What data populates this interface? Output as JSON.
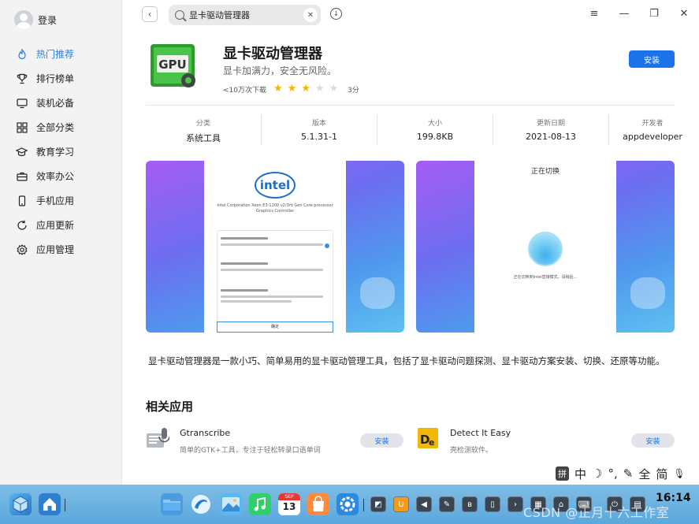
{
  "sidebar": {
    "login_label": "登录",
    "items": [
      {
        "label": "热门推荐",
        "icon": "hot-icon",
        "active": true
      },
      {
        "label": "排行榜单",
        "icon": "trophy-icon"
      },
      {
        "label": "装机必备",
        "icon": "monitor-icon"
      },
      {
        "label": "全部分类",
        "icon": "grid-icon"
      },
      {
        "label": "教育学习",
        "icon": "graduation-cap-icon"
      },
      {
        "label": "效率办公",
        "icon": "briefcase-icon"
      },
      {
        "label": "手机应用",
        "icon": "phone-icon"
      },
      {
        "label": "应用更新",
        "icon": "refresh-icon"
      },
      {
        "label": "应用管理",
        "icon": "gear-icon"
      }
    ]
  },
  "search": {
    "value": "显卡驱动管理器"
  },
  "window_controls": {
    "menu": "≡",
    "minimize": "—",
    "maximize": "❐",
    "close": "✕"
  },
  "app": {
    "icon_text": "GPU",
    "name": "显卡驱动管理器",
    "slogan": "显卡加满力，安全无风险。",
    "downloads": "<10万次下载",
    "rating_value": 3,
    "rating_max": 5,
    "rating_label": "3分",
    "install_label": "安装"
  },
  "info": [
    {
      "label": "分类",
      "value": "系统工具"
    },
    {
      "label": "版本",
      "value": "5.1.31-1"
    },
    {
      "label": "大小",
      "value": "199.8KB"
    },
    {
      "label": "更新日期",
      "value": "2021-08-13"
    },
    {
      "label": "开发者",
      "value": "appdeveloper"
    }
  ],
  "screenshots": {
    "shot1": {
      "logo": "intel",
      "processor": "Intel Corporation Xeon E3-1200 v2/3rd Gen Core processor Graphics Controller",
      "ok": "确定"
    },
    "shot2": {
      "title": "正在切换",
      "note": "正在切换到Intel直接模式，请稍后..."
    }
  },
  "description": "显卡驱动管理器是一款小巧、简单易用的显卡驱动管理工具，包括了显卡驱动问题探测、显卡驱动方案安装、切换、还原等功能。",
  "related": {
    "title": "相关应用",
    "apps": [
      {
        "name": "Gtranscribe",
        "desc": "简单的GTK+工具，专注于轻松转录口语单词",
        "button": "安装"
      },
      {
        "name": "Detect It Easy",
        "desc": "壳检测软件。",
        "button": "安装"
      }
    ]
  },
  "ime": {
    "items": [
      "拼",
      "中",
      "☽",
      "°,",
      "✎",
      "全",
      "简",
      "🎙"
    ]
  },
  "taskbar": {
    "calendar_month": "SEP",
    "calendar_day": "13",
    "clock": "16:14",
    "watermark": "CSDN @正月十六工作室"
  },
  "colors": {
    "accent": "#1a73e8",
    "star": "#f7b500",
    "taskbar": "#6fb3e0"
  }
}
